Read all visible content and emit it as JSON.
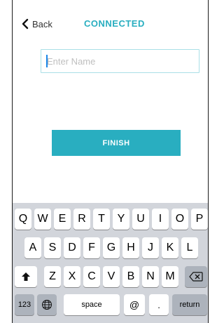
{
  "nav": {
    "back_label": "Back",
    "title": "CONNECTED",
    "back_icon": "chevron-left-icon"
  },
  "form": {
    "name_placeholder": "Enter Name",
    "name_value": ""
  },
  "actions": {
    "finish_label": "FINISH"
  },
  "colors": {
    "accent": "#29aec0",
    "keyboard_bg": "#d2d5db",
    "key_bg": "#ffffff",
    "fn_key_bg": "#adb3bc"
  },
  "keyboard": {
    "row1": [
      "Q",
      "W",
      "E",
      "R",
      "T",
      "Y",
      "U",
      "I",
      "O",
      "P"
    ],
    "row2": [
      "A",
      "S",
      "D",
      "F",
      "G",
      "H",
      "J",
      "K",
      "L"
    ],
    "row3": [
      "Z",
      "X",
      "C",
      "V",
      "B",
      "N",
      "M"
    ],
    "numbers_label": "123",
    "space_label": "space",
    "at_label": "@",
    "period_label": ".",
    "return_label": "return",
    "shift_icon": "shift-icon",
    "globe_icon": "globe-icon",
    "delete_icon": "delete-icon"
  }
}
